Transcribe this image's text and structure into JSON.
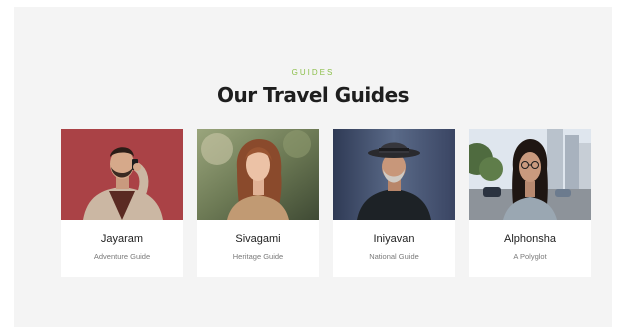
{
  "section": {
    "eyebrow": "GUIDES",
    "title": "Our Travel Guides"
  },
  "guides": [
    {
      "name": "Jayaram",
      "role": "Adventure Guide",
      "photo_icon": "man-on-phone-photo"
    },
    {
      "name": "Sivagami",
      "role": "Heritage Guide",
      "photo_icon": "woman-outdoors-photo"
    },
    {
      "name": "Iniyavan",
      "role": "National Guide",
      "photo_icon": "man-in-hat-photo"
    },
    {
      "name": "Alphonsha",
      "role": "A Polyglot",
      "photo_icon": "woman-street-photo"
    }
  ],
  "colors": {
    "accent": "#8cbf4a",
    "title": "#1e1e1e",
    "section_bg": "#f4f4f4",
    "card_bg": "#ffffff"
  }
}
